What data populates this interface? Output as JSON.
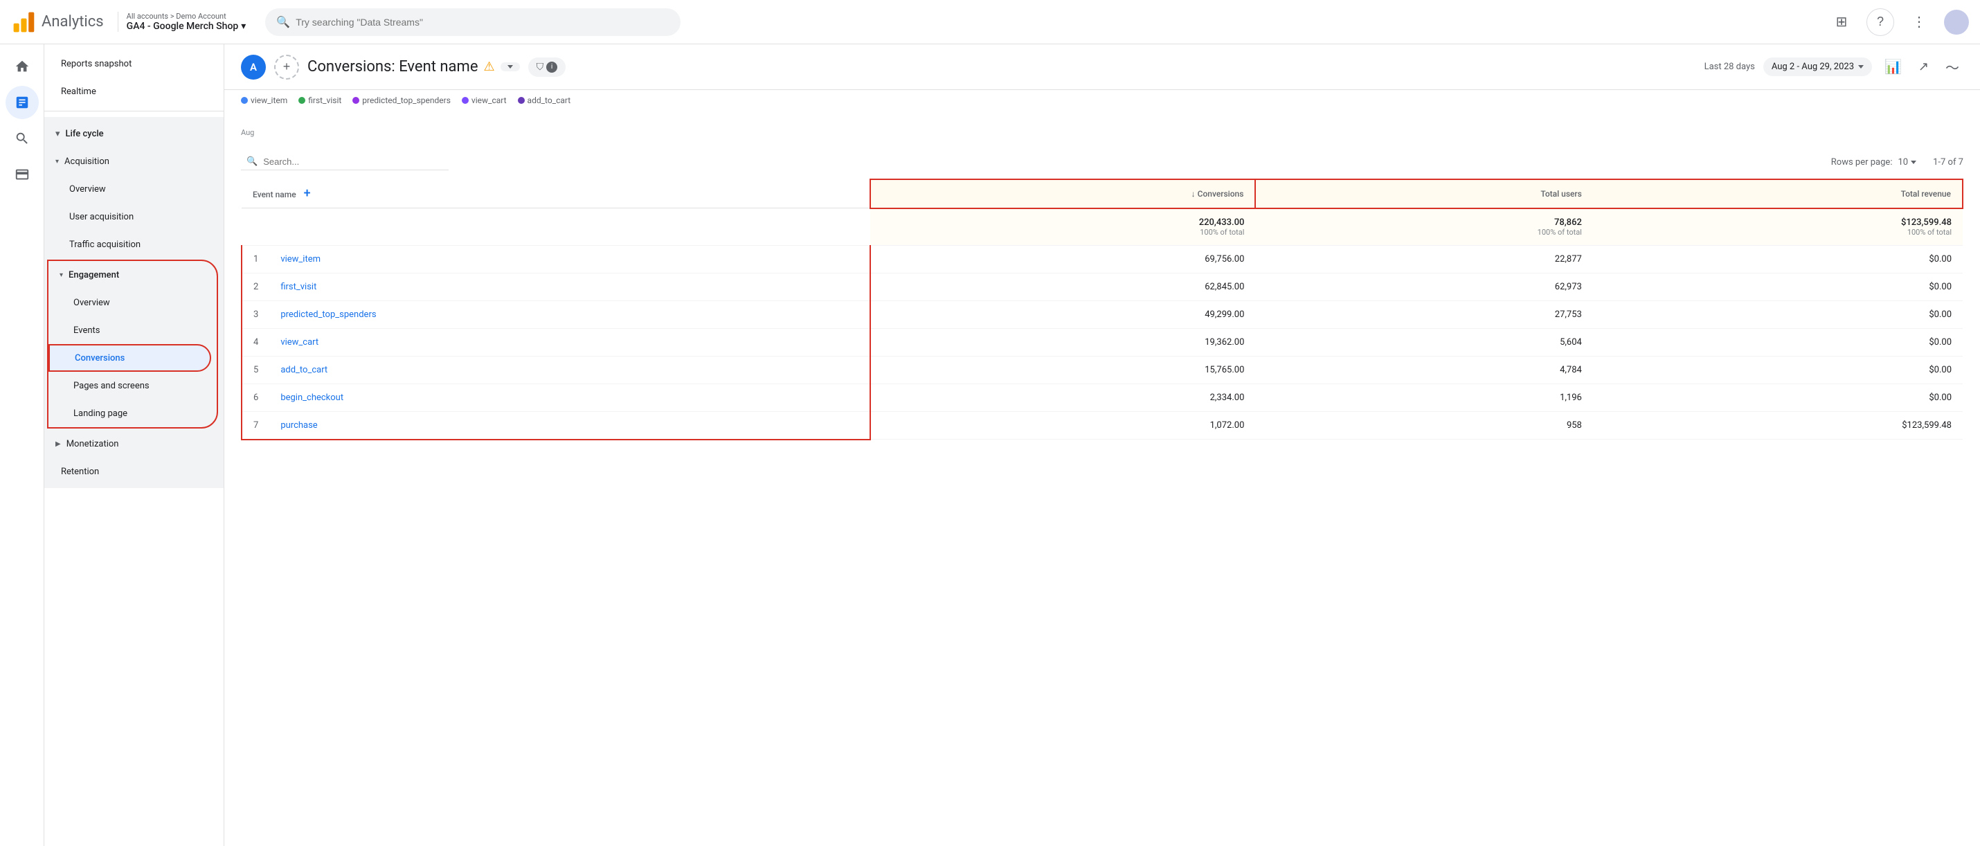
{
  "app": {
    "title": "Analytics"
  },
  "top_nav": {
    "breadcrumb": "All accounts > Demo Account",
    "account_name": "GA4 - Google Merch Shop",
    "search_placeholder": "Try searching \"Data Streams\""
  },
  "sidebar": {
    "nav_items": [
      {
        "id": "home",
        "icon": "🏠",
        "active": false
      },
      {
        "id": "reports",
        "icon": "📊",
        "active": true
      },
      {
        "id": "explore",
        "icon": "🔍",
        "active": false
      },
      {
        "id": "advertising",
        "icon": "📣",
        "active": false
      }
    ]
  },
  "left_nav": {
    "reports_snapshot": "Reports snapshot",
    "realtime": "Realtime",
    "lifecycle_label": "Life cycle",
    "acquisition": {
      "label": "Acquisition",
      "items": [
        "Overview",
        "User acquisition",
        "Traffic acquisition"
      ]
    },
    "engagement": {
      "label": "Engagement",
      "items": [
        "Overview",
        "Events",
        "Conversions",
        "Pages and screens",
        "Landing page"
      ]
    },
    "monetization": {
      "label": "Monetization"
    },
    "retention": {
      "label": "Retention"
    }
  },
  "report": {
    "title": "Conversions: Event name",
    "date_range_label": "Last 28 days",
    "date_range": "Aug 2 - Aug 29, 2023",
    "legend_items": [
      {
        "label": "view_item",
        "color": "#4285f4"
      },
      {
        "label": "first_visit",
        "color": "#34a853"
      },
      {
        "label": "predicted_top_spenders",
        "color": "#9334e6"
      },
      {
        "label": "view_cart",
        "color": "#7c4dff"
      },
      {
        "label": "add_to_cart",
        "color": "#673ab7"
      }
    ],
    "chart_label": "Aug",
    "table": {
      "search_placeholder": "Search...",
      "rows_per_page_label": "Rows per page:",
      "rows_per_page": "10",
      "pagination": "1-7 of 7",
      "headers": {
        "event_name": "Event name",
        "conversions": "↓ Conversions",
        "total_users": "Total users",
        "total_revenue": "Total revenue"
      },
      "totals": {
        "conversions": "220,433.00",
        "conversions_pct": "100% of total",
        "total_users": "78,862",
        "total_users_pct": "100% of total",
        "total_revenue": "$123,599.48",
        "total_revenue_pct": "100% of total"
      },
      "rows": [
        {
          "rank": 1,
          "event_name": "view_item",
          "conversions": "69,756.00",
          "total_users": "22,877",
          "total_revenue": "$0.00"
        },
        {
          "rank": 2,
          "event_name": "first_visit",
          "conversions": "62,845.00",
          "total_users": "62,973",
          "total_revenue": "$0.00"
        },
        {
          "rank": 3,
          "event_name": "predicted_top_spenders",
          "conversions": "49,299.00",
          "total_users": "27,753",
          "total_revenue": "$0.00"
        },
        {
          "rank": 4,
          "event_name": "view_cart",
          "conversions": "19,362.00",
          "total_users": "5,604",
          "total_revenue": "$0.00"
        },
        {
          "rank": 5,
          "event_name": "add_to_cart",
          "conversions": "15,765.00",
          "total_users": "4,784",
          "total_revenue": "$0.00"
        },
        {
          "rank": 6,
          "event_name": "begin_checkout",
          "conversions": "2,334.00",
          "total_users": "1,196",
          "total_revenue": "$0.00"
        },
        {
          "rank": 7,
          "event_name": "purchase",
          "conversions": "1,072.00",
          "total_users": "958",
          "total_revenue": "$123,599.48"
        }
      ]
    }
  },
  "icons": {
    "search": "🔍",
    "menu_grid": "⊞",
    "help": "?",
    "more_vert": "⋮",
    "chevron_down": "▾",
    "filter": "⛉",
    "info": "ⓘ",
    "add": "+",
    "warning": "⚠",
    "bar_chart": "📊",
    "share": "↗",
    "trending": "〜",
    "arrow_down": "↓"
  }
}
